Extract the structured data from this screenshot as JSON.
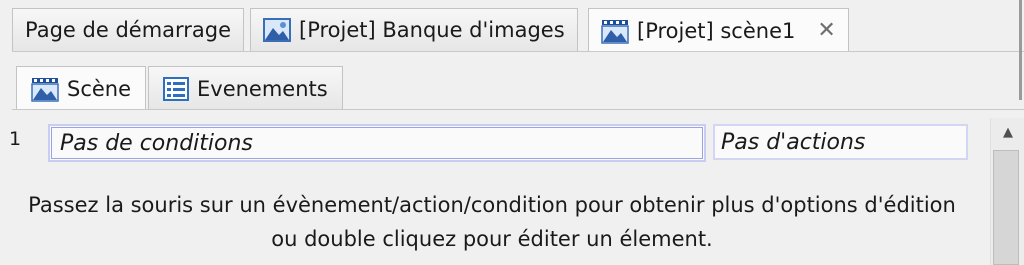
{
  "document_tabs": [
    {
      "label": "Page de démarrage",
      "icon": null,
      "active": false
    },
    {
      "label": "[Projet] Banque d'images",
      "icon": "image-bank-icon",
      "active": false
    },
    {
      "label": "[Projet] scène1",
      "icon": "scene-icon",
      "active": true,
      "close_glyph": "✕"
    }
  ],
  "editor_tabs": [
    {
      "label": "Scène",
      "icon": "scene-icon",
      "active": true
    },
    {
      "label": "Evenements",
      "icon": "event-list-icon",
      "active": false
    }
  ],
  "event": {
    "number": "1",
    "conditions_placeholder": "Pas de conditions",
    "actions_placeholder": "Pas d'actions"
  },
  "help_text": {
    "line1": "Passez la souris sur un évènement/action/condition pour obtenir plus d'options d'édition",
    "line2": "ou double cliquez pour éditer un élement."
  },
  "scrollbar": {
    "up_arrow": "▲"
  }
}
